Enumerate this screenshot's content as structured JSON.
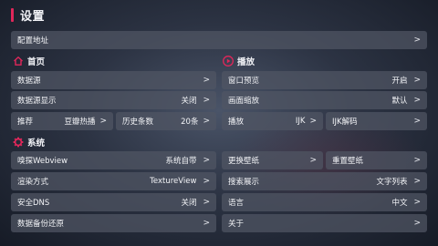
{
  "header": {
    "title": "设置"
  },
  "config_address": {
    "label": "配置地址",
    "arrow": ">"
  },
  "home_section": {
    "title": "首页",
    "icon": "home-icon",
    "data_source": {
      "label": "数据源",
      "arrow": ">"
    },
    "data_source_display": {
      "label": "数据源显示",
      "value": "关闭",
      "arrow": ">"
    },
    "recommend": {
      "label": "推荐",
      "value": "豆瓣热播",
      "arrow": ">"
    },
    "history_count": {
      "label": "历史条数",
      "value": "20条",
      "arrow": ">"
    }
  },
  "play_section": {
    "title": "播放",
    "icon": "play-circle-icon",
    "window_preview": {
      "label": "窗口预览",
      "value": "开启",
      "arrow": ">"
    },
    "screen_scale": {
      "label": "画面缩放",
      "value": "默认",
      "arrow": ">"
    },
    "player": {
      "label": "播放",
      "value": "IJK",
      "arrow": ">"
    },
    "ijk_decode": {
      "label": "IJK解码",
      "arrow": ">"
    }
  },
  "system_section": {
    "title": "系统",
    "icon": "gear-icon",
    "sniff_webview": {
      "label": "嗅探Webview",
      "value": "系统自带",
      "arrow": ">"
    },
    "render_mode": {
      "label": "渲染方式",
      "value": "TextureView",
      "arrow": ">"
    },
    "secure_dns": {
      "label": "安全DNS",
      "value": "关闭",
      "arrow": ">"
    },
    "backup_restore": {
      "label": "数据备份还原",
      "arrow": ">"
    },
    "change_wallpaper": {
      "label": "更换壁纸",
      "arrow": ">"
    },
    "reset_wallpaper": {
      "label": "重置壁纸",
      "arrow": ">"
    },
    "search_display": {
      "label": "搜索展示",
      "value": "文字列表",
      "arrow": ">"
    },
    "language": {
      "label": "语言",
      "value": "中文",
      "arrow": ">"
    },
    "about": {
      "label": "关于",
      "arrow": ">"
    }
  },
  "colors": {
    "accent": "#e0275a",
    "row_bg": "#50566499"
  }
}
